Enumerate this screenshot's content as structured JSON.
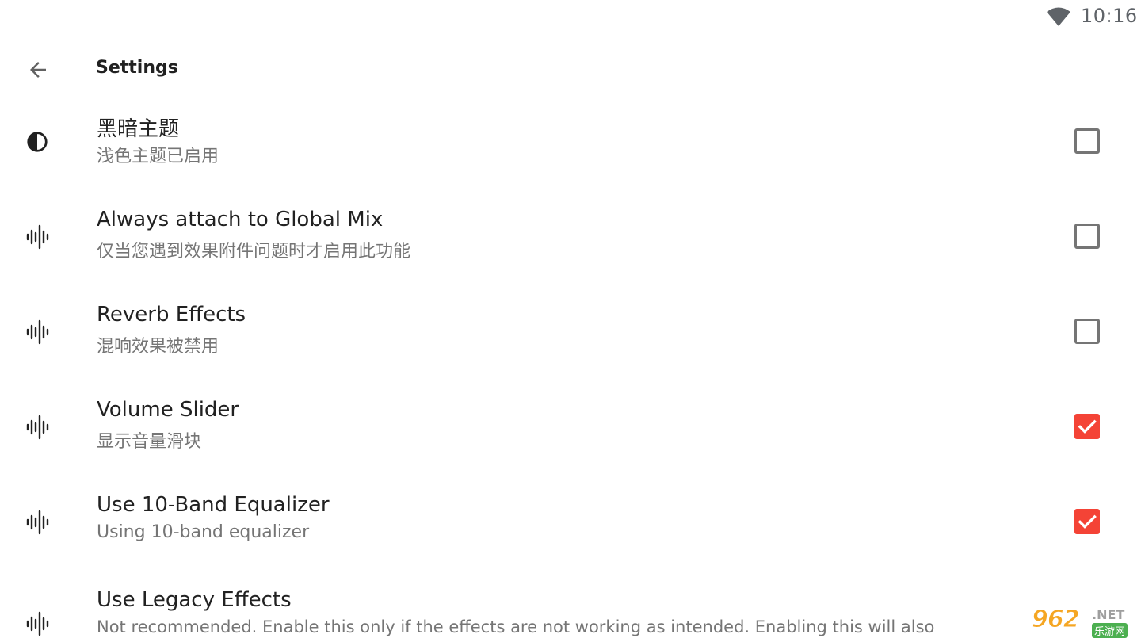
{
  "status_bar": {
    "time": "10:16",
    "wifi_icon": "wifi-icon"
  },
  "toolbar": {
    "back_icon": "arrow-back-icon",
    "title": "Settings"
  },
  "settings": [
    {
      "icon": "contrast-icon",
      "title": "黑暗主题",
      "summary": "浅色主题已启用",
      "checked": false
    },
    {
      "icon": "waveform-icon",
      "title": "Always attach to Global Mix",
      "summary": "仅当您遇到效果附件问题时才启用此功能",
      "checked": false
    },
    {
      "icon": "waveform-icon",
      "title": "Reverb Effects",
      "summary": "混响效果被禁用",
      "checked": false
    },
    {
      "icon": "waveform-icon",
      "title": "Volume Slider",
      "summary": "显示音量滑块",
      "checked": true
    },
    {
      "icon": "waveform-icon",
      "title": "Use 10-Band Equalizer",
      "summary": "Using 10-band equalizer",
      "checked": true
    },
    {
      "icon": "waveform-icon",
      "title": "Use Legacy Effects",
      "summary": "Not recommended. Enable this only if the effects are not working as intended. Enabling this will also",
      "checked": null
    }
  ],
  "watermark": {
    "main": "962",
    "net": ".NET",
    "sub": "乐游网"
  },
  "colors": {
    "accent": "#f44336",
    "text_primary": "#212121",
    "text_secondary": "#757575",
    "checkbox_border": "#757575"
  }
}
